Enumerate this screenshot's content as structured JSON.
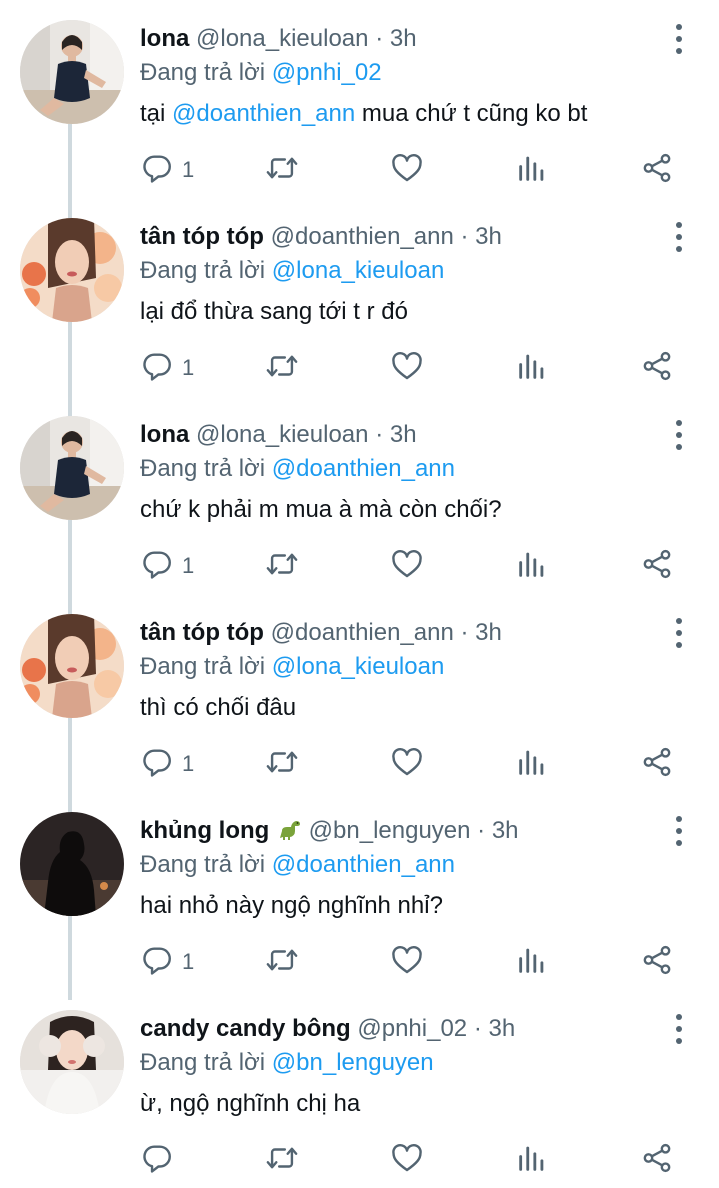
{
  "tweets": [
    {
      "name": "lona",
      "handle": "@lona_kieuloan",
      "dot": "·",
      "time": "3h",
      "reply_prefix": "Đang trả lời",
      "reply_to": "@pnhi_02",
      "text_before": "tại",
      "text_mention": "@doanthien_ann",
      "text_after": "mua chứ t cũng ko bt",
      "reply_count": "1",
      "avatar": "woman-in-black-dress-photo"
    },
    {
      "name": "tân tóp tóp",
      "handle": "@doanthien_ann",
      "dot": "·",
      "time": "3h",
      "reply_prefix": "Đang trả lời",
      "reply_to": "@lona_kieuloan",
      "text": "lại đổ thừa sang tới t r đó",
      "reply_count": "1",
      "avatar": "woman-with-flowers-photo"
    },
    {
      "name": "lona",
      "handle": "@lona_kieuloan",
      "dot": "·",
      "time": "3h",
      "reply_prefix": "Đang trả lời",
      "reply_to": "@doanthien_ann",
      "text": "chứ k phải m mua à mà còn chối?",
      "reply_count": "1",
      "avatar": "woman-in-black-dress-photo"
    },
    {
      "name": "tân tóp tóp",
      "handle": "@doanthien_ann",
      "dot": "·",
      "time": "3h",
      "reply_prefix": "Đang trả lời",
      "reply_to": "@lona_kieuloan",
      "text": "thì có chối đâu",
      "reply_count": "1",
      "avatar": "woman-with-flowers-photo"
    },
    {
      "name": "khủng long",
      "name_emoji": "dinosaur-emoji",
      "handle": "@bn_lenguyen",
      "dot": "·",
      "time": "3h",
      "reply_prefix": "Đang trả lời",
      "reply_to": "@doanthien_ann",
      "text": "hai nhỏ này ngộ nghĩnh nhỉ?",
      "reply_count": "1",
      "avatar": "dark-silhouette-photo"
    },
    {
      "name": "candy candy bông",
      "handle": "@pnhi_02",
      "dot": "·",
      "time": "3h",
      "reply_prefix": "Đang trả lời",
      "reply_to": "@bn_lenguyen",
      "text": "ừ, ngộ nghĩnh chị ha",
      "reply_count": "",
      "avatar": "woman-with-earmuffs-photo"
    }
  ],
  "icons": {
    "reply": "reply-icon",
    "retweet": "retweet-icon",
    "like": "heart-icon",
    "views": "analytics-icon",
    "share": "share-icon",
    "more": "more-options-icon"
  },
  "colors": {
    "mention": "#1d9bf0",
    "secondary_text": "#536471",
    "primary_text": "#0f1419",
    "thread_line": "#cfd9de"
  }
}
